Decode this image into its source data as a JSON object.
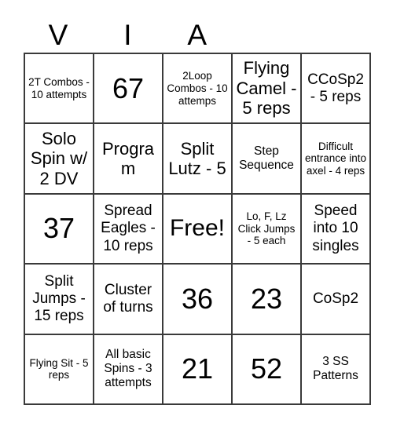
{
  "header": {
    "letters": [
      "V",
      "I",
      "A",
      "",
      ""
    ]
  },
  "grid": {
    "columns": 5,
    "rows": 5,
    "border_color": "#3a3a3a",
    "background_color": "#ffffff",
    "text_color": "#000000",
    "cells": [
      {
        "text": "2T Combos - 10 attempts",
        "size": "xs"
      },
      {
        "text": "67",
        "size": "num"
      },
      {
        "text": "2Loop Combos - 10 attemps",
        "size": "xs"
      },
      {
        "text": "Flying Camel - 5 reps",
        "size": "lg"
      },
      {
        "text": "CCoSp2 - 5 reps",
        "size": "md"
      },
      {
        "text": "Solo Spin w/ 2 DV",
        "size": "lg"
      },
      {
        "text": "Program",
        "size": "lg"
      },
      {
        "text": "Split Lutz - 5",
        "size": "lg"
      },
      {
        "text": "Step Sequence",
        "size": "sm"
      },
      {
        "text": "Difficult entrance into axel - 4 reps",
        "size": "xs"
      },
      {
        "text": "37",
        "size": "num"
      },
      {
        "text": "Spread Eagles - 10 reps",
        "size": "md"
      },
      {
        "text": "Free!",
        "size": "xl"
      },
      {
        "text": "Lo, F, Lz Click Jumps - 5 each",
        "size": "xs"
      },
      {
        "text": "Speed into 10 singles",
        "size": "md"
      },
      {
        "text": "Split Jumps - 15 reps",
        "size": "md"
      },
      {
        "text": "Cluster of turns",
        "size": "md"
      },
      {
        "text": "36",
        "size": "num"
      },
      {
        "text": "23",
        "size": "num"
      },
      {
        "text": "CoSp2",
        "size": "md"
      },
      {
        "text": "Flying Sit - 5 reps",
        "size": "xs"
      },
      {
        "text": "All basic Spins - 3 attempts",
        "size": "sm"
      },
      {
        "text": "21",
        "size": "num"
      },
      {
        "text": "52",
        "size": "num"
      },
      {
        "text": "3 SS Patterns",
        "size": "sm"
      }
    ]
  }
}
